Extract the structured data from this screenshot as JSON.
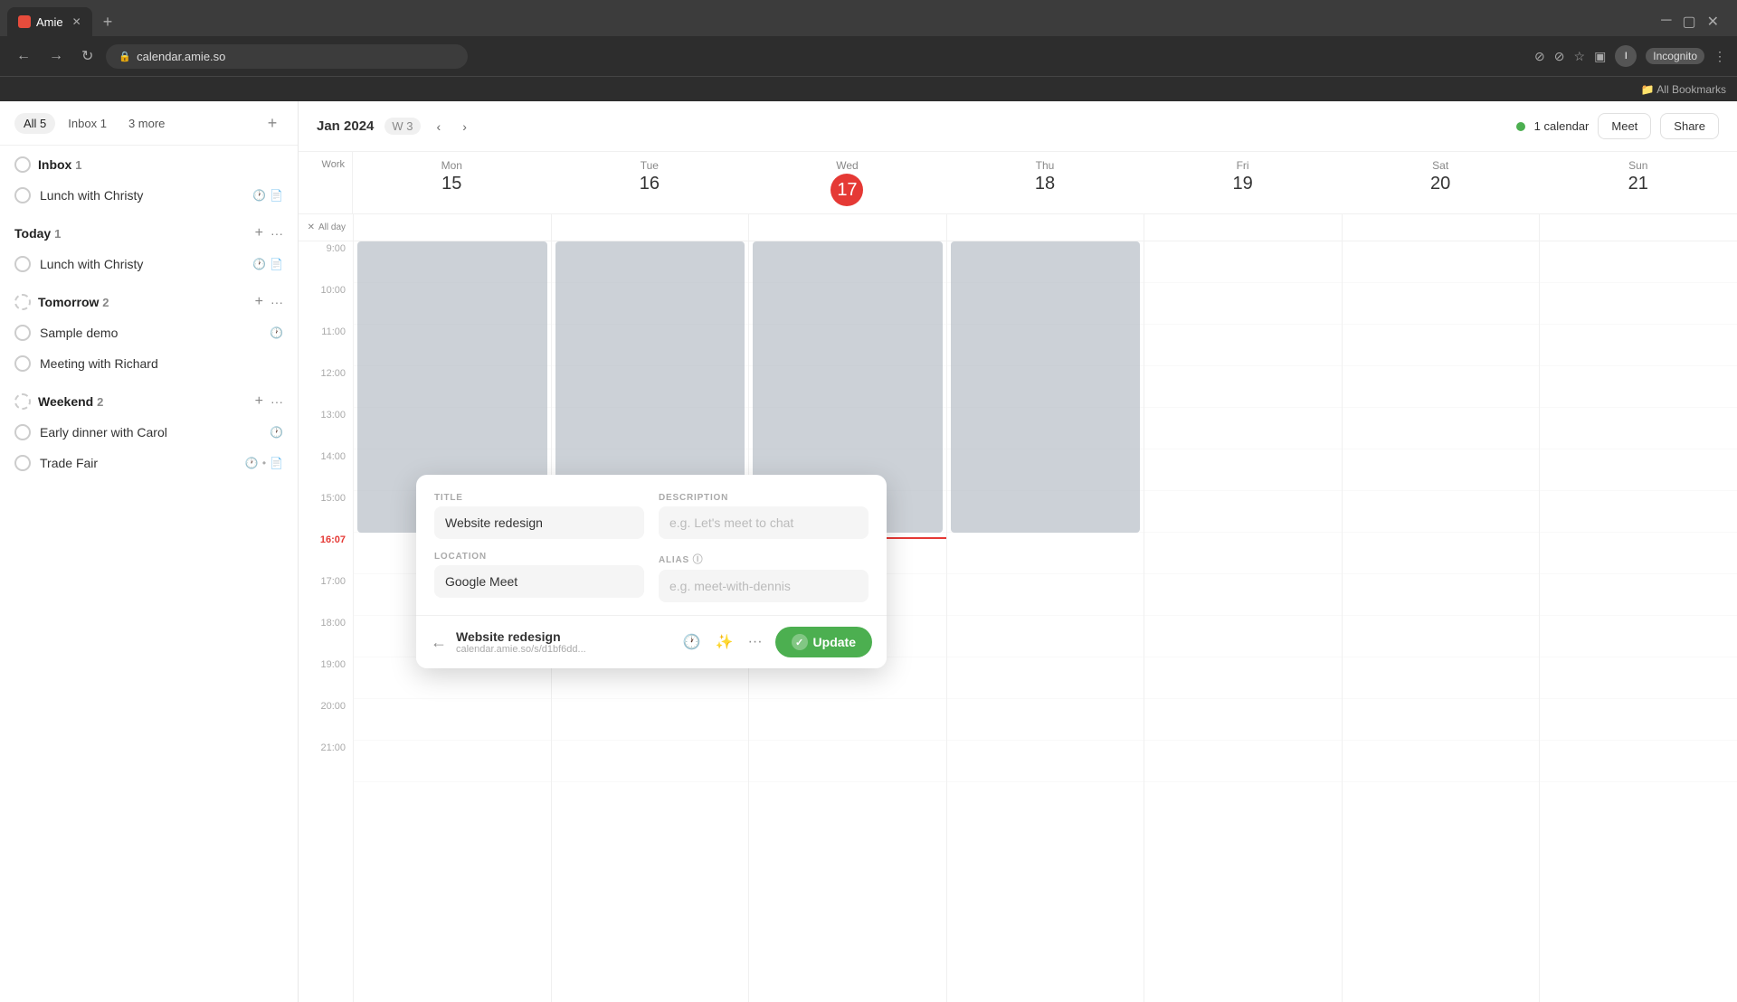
{
  "browser": {
    "tab_title": "Amie",
    "url": "calendar.amie.so",
    "incognito_label": "Incognito"
  },
  "sidebar": {
    "tabs": [
      {
        "label": "All",
        "count": "5",
        "active": true
      },
      {
        "label": "Inbox",
        "count": "1",
        "active": false
      },
      {
        "label": "3 more",
        "active": false
      }
    ],
    "sections": [
      {
        "id": "inbox",
        "label": "Inbox",
        "count": "1",
        "has_add": false,
        "has_more": false,
        "items": [
          {
            "id": "lunch-christy-1",
            "label": "Lunch with Christy",
            "circle_type": "normal",
            "icons": [
              "clock",
              "doc"
            ]
          },
          {
            "id": "today",
            "label": "Today",
            "count": "1",
            "is_section": true,
            "has_add": true,
            "has_more": true
          },
          {
            "id": "lunch-christy-2",
            "label": "Lunch with Christy",
            "circle_type": "normal",
            "icons": [
              "clock",
              "doc"
            ]
          },
          {
            "id": "tomorrow",
            "label": "Tomorrow",
            "count": "2",
            "is_section": true,
            "has_add": true,
            "has_more": true
          },
          {
            "id": "sample-demo",
            "label": "Sample demo",
            "circle_type": "normal",
            "icons": [
              "clock"
            ]
          },
          {
            "id": "meeting-richard",
            "label": "Meeting with Richard",
            "circle_type": "normal",
            "icons": []
          },
          {
            "id": "weekend",
            "label": "Weekend",
            "count": "2",
            "is_section": true,
            "has_add": true,
            "has_more": true
          },
          {
            "id": "early-dinner",
            "label": "Early dinner with Carol",
            "circle_type": "normal",
            "icons": [
              "clock"
            ]
          },
          {
            "id": "trade-fair",
            "label": "Trade Fair",
            "circle_type": "normal",
            "icons": [
              "clock",
              "dot",
              "doc"
            ]
          }
        ]
      }
    ]
  },
  "calendar": {
    "month_year": "Jan 2024",
    "week": "W 3",
    "calendar_label": "1 calendar",
    "meet_label": "Meet",
    "share_label": "Share",
    "days": [
      {
        "name": "Mon",
        "num": "15",
        "is_today": false
      },
      {
        "name": "Tue",
        "num": "16",
        "is_today": false
      },
      {
        "name": "Wed",
        "num": "17",
        "is_today": true
      },
      {
        "name": "Thu",
        "num": "18",
        "is_today": false
      },
      {
        "name": "Fri",
        "num": "19",
        "is_today": false
      },
      {
        "name": "Sat",
        "num": "20",
        "is_today": false
      },
      {
        "name": "Sun",
        "num": "21",
        "is_today": false
      }
    ],
    "work_label": "Work",
    "all_day_label": "All day",
    "time_slots": [
      "9:00",
      "10:00",
      "11:00",
      "12:00",
      "13:00",
      "14:00",
      "15:00",
      "16:07",
      "17:00",
      "18:00",
      "19:00",
      "20:00",
      "21:00"
    ],
    "current_time": "16:07"
  },
  "popup": {
    "title_label": "TITLE",
    "title_value": "Website redesign",
    "description_label": "DESCRIPTION",
    "description_placeholder": "e.g. Let's meet to chat",
    "location_label": "LOCATION",
    "location_value": "Google Meet",
    "alias_label": "ALIAS",
    "alias_placeholder": "e.g. meet-with-dennis",
    "event_title": "Website redesign",
    "event_url": "calendar.amie.so/s/d1bf6dd...",
    "update_label": "Update"
  }
}
